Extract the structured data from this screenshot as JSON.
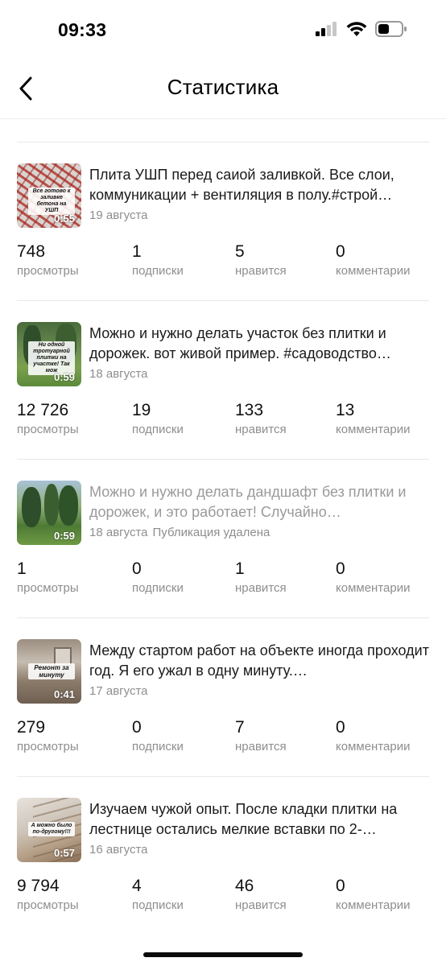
{
  "status_bar": {
    "time": "09:33"
  },
  "nav": {
    "title": "Статистика"
  },
  "stat_labels": {
    "views": "просмотры",
    "subs": "подписки",
    "likes": "нравится",
    "comments": "комментарии"
  },
  "posts": [
    {
      "text": "Плита УШП перед саиой заливкой. Все слои, коммуникации + вентиляция в полу.#строй…",
      "date": "19 августа",
      "removed": "",
      "deleted": false,
      "duration": "0:55",
      "caption": "Все готово к заливке бетона на УШП",
      "views": "748",
      "subs": "1",
      "likes": "5",
      "comments": "0"
    },
    {
      "text": "Можно и нужно делать участок без плитки и дорожек. вот живой пример. #садоводство…",
      "date": "18 августа",
      "removed": "",
      "deleted": false,
      "duration": "0:59",
      "caption": "Ни одной тротуарной плитки на участке! Так мож",
      "views": "12 726",
      "subs": "19",
      "likes": "133",
      "comments": "13"
    },
    {
      "text": "Можно и нужно делать дандшафт без плитки и дорожек, и это работает! Случайно…",
      "date": "18 августа",
      "removed": "Публикация удалена",
      "deleted": true,
      "duration": "0:59",
      "caption": "",
      "views": "1",
      "subs": "0",
      "likes": "1",
      "comments": "0"
    },
    {
      "text": "Между стартом работ на объекте иногда проходит год. Я его ужал в одну минуту.…",
      "date": "17 августа",
      "removed": "",
      "deleted": false,
      "duration": "0:41",
      "caption": "Ремонт за минуту",
      "views": "279",
      "subs": "0",
      "likes": "7",
      "comments": "0"
    },
    {
      "text": "Изучаем чужой опыт. После кладки плитки на лестнице остались мелкие вставки по 2-…",
      "date": "16 августа",
      "removed": "",
      "deleted": false,
      "duration": "0:57",
      "caption": "А можно было по-другому!!!",
      "views": "9 794",
      "subs": "4",
      "likes": "46",
      "comments": "0"
    }
  ]
}
